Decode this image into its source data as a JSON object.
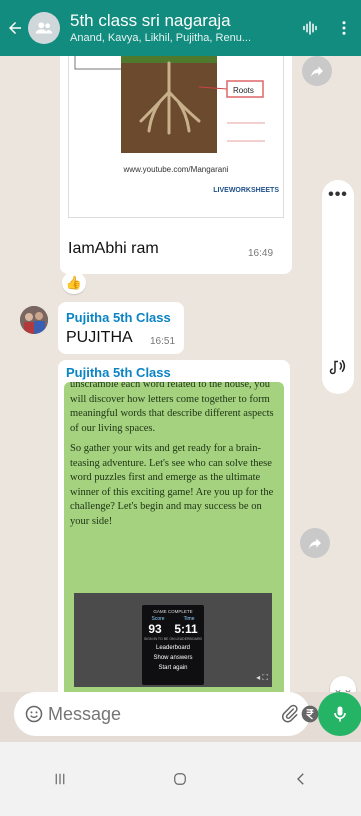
{
  "header": {
    "title": "5th class sri nagaraja",
    "members": "Anand, Kavya, Likhil, Pujitha, Renu...",
    "colors": {
      "background": "#128c7e"
    }
  },
  "messages": [
    {
      "type": "image",
      "image": {
        "roots_label": "Roots",
        "caption": "www.youtube.com/Mangarani",
        "logo": "LIVEWORKSHEETS"
      },
      "text": "IamAbhi ram",
      "time": "16:49",
      "reaction": "👍"
    },
    {
      "type": "text",
      "sender": "Pujitha 5th Class",
      "text": "PUJITHA",
      "time": "16:51"
    },
    {
      "type": "image",
      "sender": "Pujitha 5th Class",
      "image": {
        "paragraphs": [
          "unscramble each word related to the house, you will discover how letters come together to form meaningful words that describe different aspects of our living spaces.",
          "So gather your wits and get ready for a brain-teasing adventure. Let's see who can solve these word puzzles first and emerge as the ultimate winner of this exciting game! Are you up for the challenge? Let's begin and may success be on your side!"
        ],
        "game_card": {
          "title": "GAME COMPLETE",
          "score_label": "Score",
          "time_label": "Time",
          "score": "93",
          "time": "5:11",
          "subtitle": "SIGN IN TO BE ON LEADERBOARD",
          "buttons": [
            "Leaderboard",
            "Show answers",
            "Start again"
          ]
        }
      }
    }
  ],
  "input": {
    "placeholder": "Message"
  },
  "icons": {
    "back": "back-arrow-icon",
    "avatar": "group-icon",
    "voice_call": "waveform-icon",
    "menu": "more-vert-icon",
    "emoji": "emoji-icon",
    "attach": "paperclip-icon",
    "payment": "rupee-icon",
    "camera": "camera-icon",
    "mic": "mic-icon"
  }
}
